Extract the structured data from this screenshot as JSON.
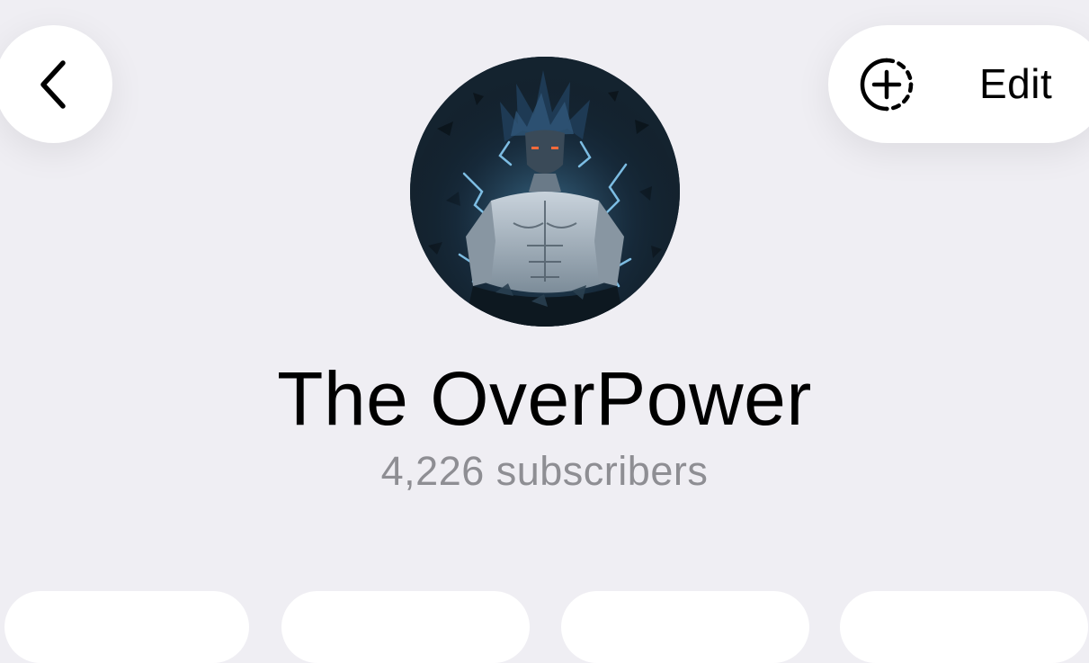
{
  "header": {
    "back_icon": "chevron-left-icon",
    "story_icon": "add-story-icon",
    "edit_label": "Edit"
  },
  "profile": {
    "avatar": "channel-avatar-anime-warrior",
    "name": "The OverPower",
    "subscribers": "4,226 subscribers"
  },
  "action_cards": [
    {
      "name": "action-card-1"
    },
    {
      "name": "action-card-2"
    },
    {
      "name": "action-card-3"
    },
    {
      "name": "action-card-4"
    }
  ],
  "colors": {
    "background": "#efeef3",
    "card": "#ffffff",
    "text_primary": "#000000",
    "text_secondary": "#8e8e93"
  }
}
